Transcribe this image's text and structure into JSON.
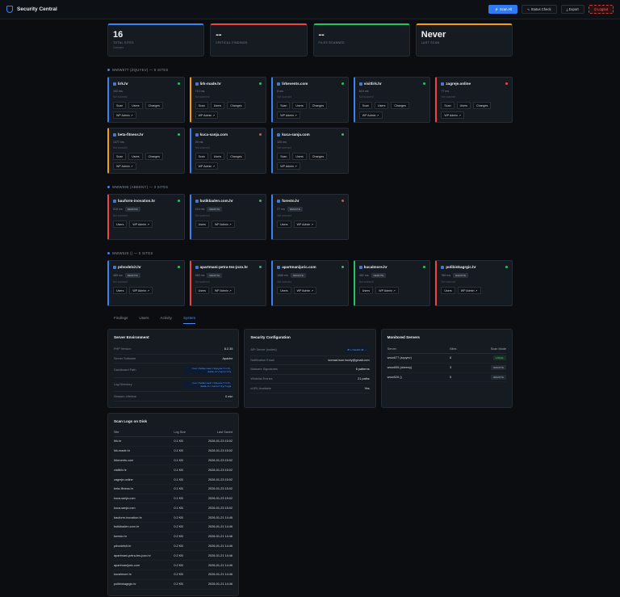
{
  "app": {
    "title": "Security Central"
  },
  "toolbar": {
    "scan_all": "⚡ Scan All",
    "status_check": "∿ Status Check",
    "export": "⤓ Export",
    "logout": "⏻ Logout"
  },
  "colors": {
    "accent": "#3b82f6",
    "danger": "#ef4444",
    "success": "#22c55e",
    "warning": "#f59e0b"
  },
  "stats": [
    {
      "num": "16",
      "label": "TOTAL SITES",
      "sub": "3 servers",
      "color": "#3b82f6"
    },
    {
      "num": "--",
      "label": "CRITICAL FINDINGS",
      "sub": "",
      "color": "#ef4444"
    },
    {
      "num": "--",
      "label": "FILES SCANNED",
      "sub": "",
      "color": "#22c55e"
    },
    {
      "num": "Never",
      "label": "LAST SCAN",
      "sub": "",
      "color": "#f59e0b"
    }
  ],
  "groups": [
    {
      "title": "WWW677 (ZQUYEV) — 8 SITES",
      "sites": [
        {
          "name": "lirk.hr",
          "ms": "102 ms",
          "remote": false,
          "status": "up",
          "accent": "#3b82f6",
          "users": true,
          "changes": true
        },
        {
          "name": "lirk-made.hr",
          "ms": "710 ms",
          "remote": false,
          "status": "up",
          "accent": "#f59e0b",
          "users": true,
          "changes": true
        },
        {
          "name": "lirkevents.com",
          "ms": "8 ms",
          "remote": false,
          "status": "up",
          "accent": "#3b82f6",
          "users": true,
          "changes": true
        },
        {
          "name": "visitlirk.hr",
          "ms": "619 ms",
          "remote": false,
          "status": "up",
          "accent": "#3b82f6",
          "users": true,
          "changes": true
        },
        {
          "name": "zagreje.online",
          "ms": "77 ms",
          "remote": false,
          "status": "down",
          "accent": "#ef4444",
          "users": true,
          "changes": true
        },
        {
          "name": "beta-fitness.hr",
          "ms": "1477 ms",
          "remote": false,
          "status": "up",
          "accent": "#f59e0b",
          "users": true,
          "changes": true
        },
        {
          "name": "kuca-sanja.com",
          "ms": "26 ms",
          "remote": false,
          "status": "down",
          "accent": "#3b82f6",
          "users": true,
          "changes": true
        },
        {
          "name": "kuca-sanja.com",
          "ms": "320 ms",
          "remote": false,
          "status": "up",
          "accent": "#3b82f6",
          "users": true,
          "changes": true
        }
      ]
    },
    {
      "title": "WWW695 (ABEENY) — 3 SITES",
      "sites": [
        {
          "name": "bauform-inovation.hr",
          "ms": "518 ms",
          "remote": true,
          "status": "up",
          "accent": "#ef4444",
          "users": false,
          "changes": false
        },
        {
          "name": "butikbaden.com.hr",
          "ms": "416 ms",
          "remote": true,
          "status": "up",
          "accent": "#3b82f6",
          "users": false,
          "changes": false
        },
        {
          "name": "foresto.hr",
          "ms": "27 ms",
          "remote": true,
          "status": "down",
          "accent": "#3b82f6",
          "users": false,
          "changes": false
        }
      ]
    },
    {
      "title": "WWW526 () — 5 SITES",
      "sites": [
        {
          "name": "pdvodelcit.hr",
          "ms": "485 ms",
          "remote": true,
          "status": "up",
          "accent": "#3b82f6",
          "users": false,
          "changes": false
        },
        {
          "name": "apartmani-petra-tes-jozo.hr",
          "ms": "460 ms",
          "remote": true,
          "status": "up",
          "accent": "#ef4444",
          "users": false,
          "changes": false
        },
        {
          "name": "apartmanijuric.com",
          "ms": "1086 ms",
          "remote": true,
          "status": "up",
          "accent": "#3b82f6",
          "users": false,
          "changes": false
        },
        {
          "name": "kucalmore.hr",
          "ms": "482 ms",
          "remote": true,
          "status": "up",
          "accent": "#22c55e",
          "users": false,
          "changes": false
        },
        {
          "name": "polibinkagrgic.hr",
          "ms": "786 ms",
          "remote": true,
          "status": "up",
          "accent": "#ef4444",
          "users": false,
          "changes": false
        }
      ]
    }
  ],
  "card_labels": {
    "scan": "Scan",
    "users": "Users",
    "changes": "Changes",
    "wp_admin": "WP Admin ↗",
    "never_scanned": "Not scanned",
    "remote": "REMOTE"
  },
  "tabs": [
    "Findings",
    "Users",
    "Activity",
    "System"
  ],
  "active_tab": 3,
  "server_env": {
    "title": "Server Environment",
    "rows": [
      {
        "k": "PHP Version",
        "v": "8.2.35",
        "code": false
      },
      {
        "k": "Server Software",
        "v": "Apache",
        "code": false
      },
      {
        "k": "Dashboard Path",
        "v": "/usr/home/user/zquyev/lirk-made.hr/security",
        "code": true
      },
      {
        "k": "Log Directory",
        "v": "/usr/home/user/zquyev/lirk-made.hr/security/logs",
        "code": true
      },
      {
        "k": "Session Lifetime",
        "v": "0 min",
        "code": false
      }
    ]
  },
  "sec_config": {
    "title": "Security Configuration",
    "rows": [
      {
        "k": "API Server (nodes)",
        "v": "#lirkadmin#...",
        "code": true
      },
      {
        "k": "Notification Email",
        "v": "konrad.ison.booty@gmail.com",
        "code": false
      },
      {
        "k": "Malware Signatures",
        "v": "6 patterns",
        "code": false
      },
      {
        "k": "Whitelist Entries",
        "v": "21 paths",
        "code": false
      },
      {
        "k": "cURL Available",
        "v": "Yes",
        "code": false
      }
    ]
  },
  "servers": {
    "title": "Monitored Servers",
    "headers": [
      "Server",
      "Sites",
      "Scan Mode"
    ],
    "rows": [
      {
        "name": "www677 (zquyev)",
        "sites": "8",
        "mode": "LOCAL"
      },
      {
        "name": "www695 (abeeny)",
        "sites": "3",
        "mode": "REMOTE"
      },
      {
        "name": "www526 ()",
        "sites": "5",
        "mode": "REMOTE"
      }
    ]
  },
  "logs": {
    "title": "Scan Logs on Disk",
    "headers": [
      "Site",
      "Log Size",
      "Last Saved"
    ],
    "rows": [
      [
        "lirk.hr",
        "0.1 KB",
        "2026-01-23 15:02"
      ],
      [
        "lirk-made.hr",
        "0.1 KB",
        "2026-01-23 15:02"
      ],
      [
        "lirkevents.com",
        "0.1 KB",
        "2026-01-23 15:02"
      ],
      [
        "visitlirk.hr",
        "0.1 KB",
        "2026-01-23 15:02"
      ],
      [
        "zagreje.online",
        "0.1 KB",
        "2026-01-23 15:02"
      ],
      [
        "beta-fitness.hr",
        "0.1 KB",
        "2026-01-23 15:02"
      ],
      [
        "kuca-sanja.com",
        "0.1 KB",
        "2026-01-23 15:02"
      ],
      [
        "kuca-sanja.com",
        "0.1 KB",
        "2026-01-23 15:02"
      ],
      [
        "bauform-inovation.hr",
        "0.2 KB",
        "2026-01-21 14:46"
      ],
      [
        "butikbaden.com.hr",
        "0.2 KB",
        "2026-01-21 14:46"
      ],
      [
        "foresto.hr",
        "0.2 KB",
        "2026-01-21 14:46"
      ],
      [
        "pdvodelcit.hr",
        "0.2 KB",
        "2026-01-21 14:46"
      ],
      [
        "apartmani-petra-tes-jozo.hr",
        "0.2 KB",
        "2026-01-21 14:46"
      ],
      [
        "apartmanijuric.com",
        "0.2 KB",
        "2026-01-21 14:46"
      ],
      [
        "kucalmore.hr",
        "0.2 KB",
        "2026-01-21 14:46"
      ],
      [
        "polibinkagrgic.hr",
        "0.2 KB",
        "2026-01-21 14:46"
      ]
    ]
  }
}
